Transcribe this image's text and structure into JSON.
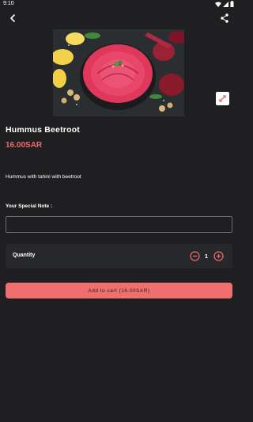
{
  "status_bar": {
    "time": "9:10"
  },
  "product": {
    "name": "Hummus Beetroot",
    "price": "16.00SAR",
    "description": "Hummus with tahini with beetroot"
  },
  "note": {
    "label": "Your Special Note :",
    "value": "",
    "placeholder": ""
  },
  "quantity": {
    "label": "Quantity",
    "value": "1"
  },
  "cart_button": {
    "label": "Add to cart (16.00SAR)"
  },
  "colors": {
    "background": "#1f1f21",
    "accent": "#ef6a6a",
    "card": "#27282b"
  },
  "icons": {
    "back": "arrow-back-icon",
    "share": "share-icon",
    "expand": "expand-icon",
    "minus": "minus-circle-icon",
    "plus": "plus-circle-icon"
  }
}
